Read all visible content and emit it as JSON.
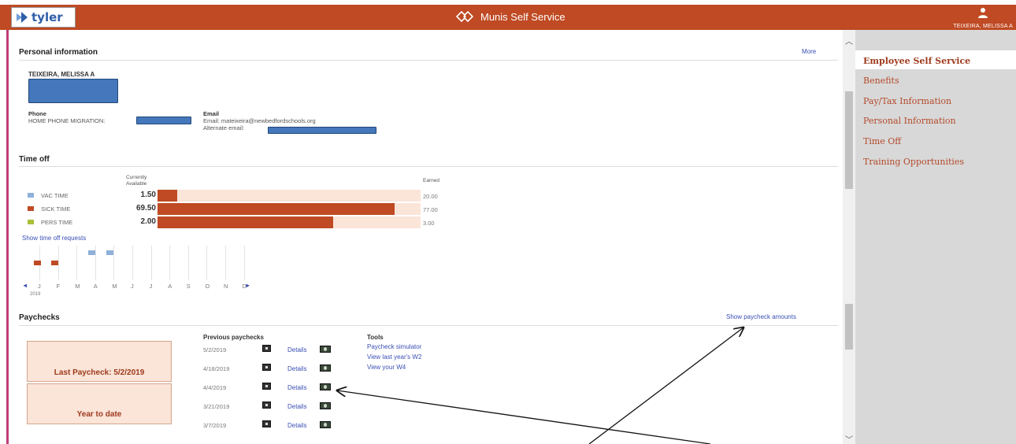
{
  "header": {
    "logo_text": "tyler",
    "app_title": "Munis Self Service",
    "user_name": "TEIXEIRA, MELISSA A",
    "brand_color": "#bf4a23"
  },
  "sidebar": {
    "items": [
      {
        "label": "Employee Self Service",
        "active": true
      },
      {
        "label": "Benefits",
        "active": false
      },
      {
        "label": "Pay/Tax Information",
        "active": false
      },
      {
        "label": "Personal Information",
        "active": false
      },
      {
        "label": "Time Off",
        "active": false
      },
      {
        "label": "Training Opportunities",
        "active": false
      }
    ]
  },
  "personal": {
    "title": "Personal information",
    "more_link": "More",
    "name": "TEIXEIRA, MELISSA A",
    "phone_label": "Phone",
    "phone_value": "HOME PHONE MIGRATION:",
    "email_label": "Email",
    "email_value": "Email: mateixeira@newbedfordschools.org",
    "alt_email": "Alternate email:"
  },
  "time_off": {
    "title": "Time off",
    "col_available": "Currently Available",
    "col_earned": "Earned",
    "rows": [
      {
        "label": "VAC TIME",
        "available": "1.50",
        "earned": "20.00",
        "color": "#8fb0d8",
        "fill_ratio": 0.075
      },
      {
        "label": "SICK TIME",
        "available": "69.50",
        "earned": "77.00",
        "color": "#bf4a23",
        "fill_ratio": 0.9
      },
      {
        "label": "PERS TIME",
        "available": "2.00",
        "earned": "3.00",
        "color": "#a9c03a",
        "fill_ratio": 0.667
      }
    ],
    "show_requests_link": "Show time off requests",
    "months": [
      "J",
      "F",
      "M",
      "A",
      "M",
      "J",
      "J",
      "A",
      "S",
      "O",
      "N",
      "D"
    ],
    "year": "2019",
    "prev_arrow": "◄",
    "next_arrow": "►"
  },
  "paychecks": {
    "title": "Paychecks",
    "show_amounts_link": "Show paycheck amounts",
    "last_paycheck": "Last Paycheck: 5/2/2019",
    "year_to_date": "Year to date",
    "previous_header": "Previous paychecks",
    "previous": [
      {
        "date": "5/2/2019",
        "details": "Details"
      },
      {
        "date": "4/18/2019",
        "details": "Details"
      },
      {
        "date": "4/4/2019",
        "details": "Details"
      },
      {
        "date": "3/21/2019",
        "details": "Details"
      },
      {
        "date": "3/7/2019",
        "details": "Details"
      }
    ],
    "tools_header": "Tools",
    "tools": [
      "Paycheck simulator",
      "View last year's W2",
      "View your W4"
    ]
  }
}
